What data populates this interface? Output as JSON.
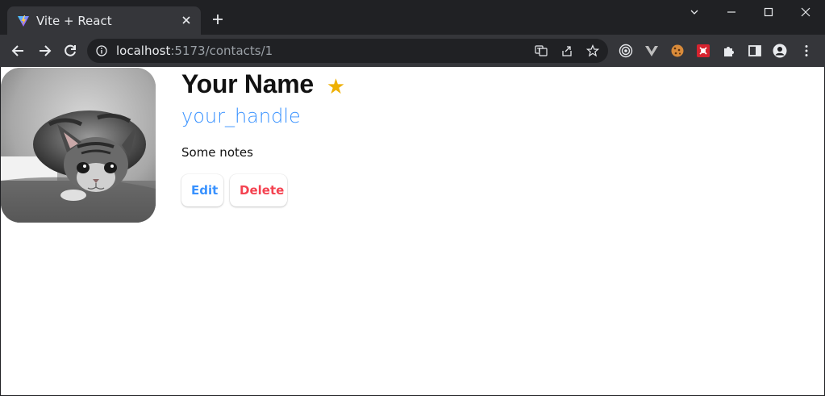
{
  "browser": {
    "tab": {
      "title": "Vite + React"
    },
    "address": {
      "host": "localhost",
      "path": ":5173/contacts/1"
    },
    "colors": {
      "titlebar": "#202124",
      "toolbar": "#35363a",
      "omnibox": "#202124"
    }
  },
  "contact": {
    "name": "Your Name",
    "favorite_star": "★",
    "handle": "your_handle",
    "notes": "Some notes",
    "avatar": "kitten-photo"
  },
  "actions": {
    "edit_label": "Edit",
    "delete_label": "Delete"
  },
  "colors": {
    "accent": "#3992ff",
    "danger": "#f44250",
    "star": "#eeb004"
  }
}
